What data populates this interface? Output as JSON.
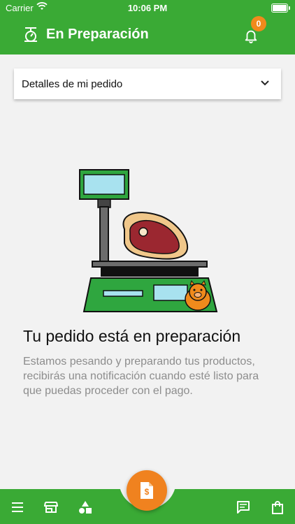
{
  "status_bar": {
    "carrier": "Carrier",
    "time": "10:06 PM"
  },
  "header": {
    "title": "En Preparación",
    "logo_icon": "scale-icon",
    "notification_icon": "bell-icon",
    "notification_count": "0"
  },
  "details": {
    "label": "Detalles de mi pedido",
    "toggle_icon": "chevron-down-icon"
  },
  "main": {
    "title": "Tu pedido está en preparación",
    "description": "Estamos pesando y preparando tus productos, recibirás una notificación cuando esté listo para que puedas proceder con el pago."
  },
  "bottom_nav": {
    "items": [
      "menu-icon",
      "store-icon",
      "categories-icon",
      "chat-icon",
      "bag-icon"
    ],
    "fab_icon": "receipt-dollar-icon"
  },
  "colors": {
    "primary_green": "#3aaa35",
    "accent_orange": "#f08a1c",
    "background": "#f2f2f2",
    "text_dark": "#111111",
    "text_muted": "#8d8d8d"
  }
}
